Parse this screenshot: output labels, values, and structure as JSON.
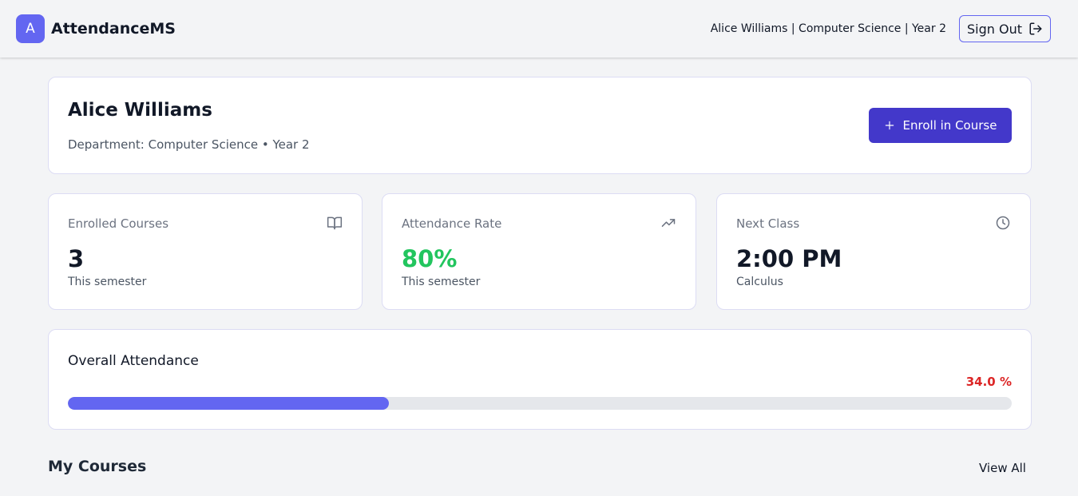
{
  "header": {
    "logo_letter": "A",
    "app_name": "AttendanceMS",
    "user_info": "Alice Williams | Computer Science | Year 2",
    "sign_out_label": "Sign Out",
    "sign_out_icon": "log-out-icon"
  },
  "profile": {
    "name": "Alice Williams",
    "subtitle": "Department: Computer Science • Year 2",
    "enroll_label": "Enroll in Course",
    "enroll_icon": "plus-icon"
  },
  "stats": [
    {
      "label": "Enrolled Courses",
      "value": "3",
      "sub": "This semester",
      "icon": "book-open-icon"
    },
    {
      "label": "Attendance Rate",
      "value": "80%",
      "sub": "This semester",
      "icon": "trending-up-icon",
      "value_color": "#22c55e"
    },
    {
      "label": "Next Class",
      "value": "2:00 PM",
      "sub": "Calculus",
      "icon": "clock-icon"
    }
  ],
  "overall_attendance": {
    "title": "Overall Attendance",
    "percent_label": "34.0 %",
    "progress": 0.34,
    "bar_color": "#6366f1",
    "percent_color": "#dc2626"
  },
  "courses_section": {
    "title": "My Courses",
    "view_all_label": "View All"
  }
}
